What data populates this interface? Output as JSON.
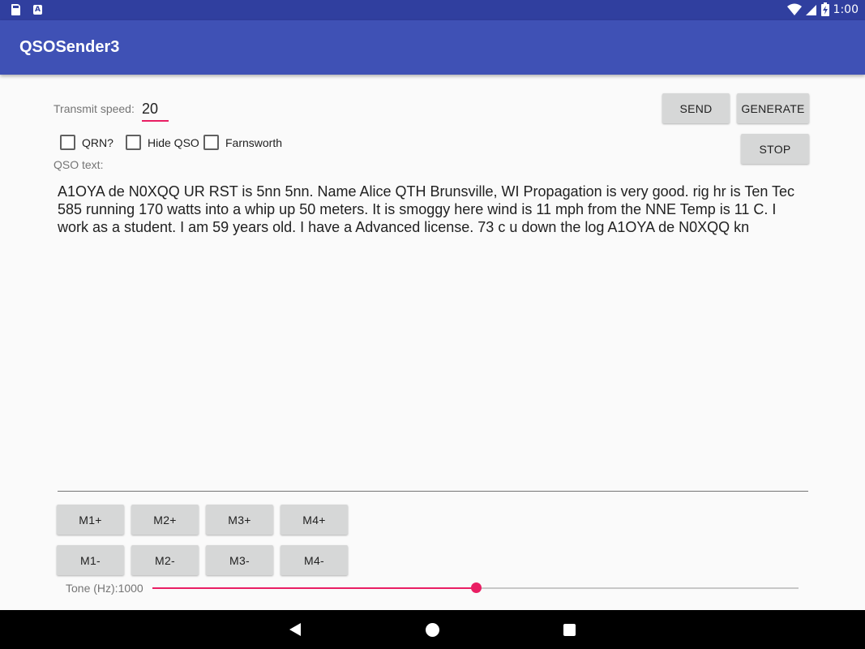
{
  "status_bar": {
    "time": "1:00",
    "icons": [
      "sd-card-icon",
      "a-notification-icon",
      "wifi-icon",
      "cell-signal-icon",
      "battery-charging-icon"
    ]
  },
  "app": {
    "title": "QSOSender3"
  },
  "speed": {
    "label": "Transmit speed:",
    "value": "20"
  },
  "buttons": {
    "send": "SEND",
    "generate": "GENERATE",
    "stop": "STOP"
  },
  "checkboxes": [
    {
      "label": "QRN?",
      "checked": false
    },
    {
      "label": "Hide QSO",
      "checked": false
    },
    {
      "label": "Farnsworth",
      "checked": false
    }
  ],
  "qso": {
    "label": "QSO text:",
    "text": "A1OYA de N0XQQ UR RST is 5nn 5nn. Name Alice QTH Brunsville, WI Propagation is very good. rig  hr is Ten Tec 585 running 170 watts into a whip up 50 meters. It is smoggy here wind is 11 mph from the NNE Temp is 11 C. I work as a student. I am 59 years old. I have a Advanced license. 73 c u down the log A1OYA de N0XQQ kn"
  },
  "memory_buttons": {
    "plus": [
      "M1+",
      "M2+",
      "M3+",
      "M4+"
    ],
    "minus": [
      "M1-",
      "M2-",
      "M3-",
      "M4-"
    ]
  },
  "tone": {
    "label": "Tone (Hz):1000",
    "level": 0.5
  },
  "colors": {
    "primary": "#3f51b5",
    "primary_dark": "#303f9f",
    "accent": "#e91e63"
  }
}
